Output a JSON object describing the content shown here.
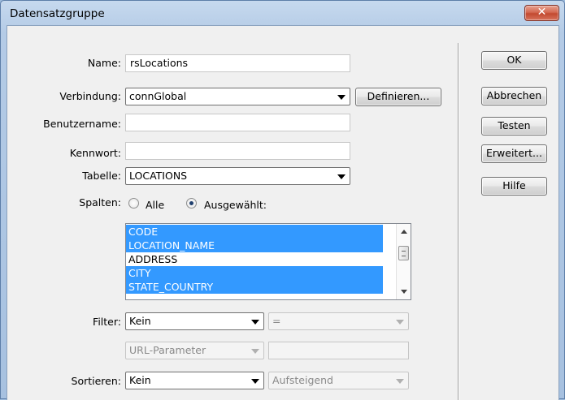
{
  "window": {
    "title": "Datensatzgruppe",
    "close_glyph": "✕"
  },
  "labels": {
    "name": "Name:",
    "connection": "Verbindung:",
    "username": "Benutzername:",
    "password": "Kennwort:",
    "table": "Tabelle:",
    "columns": "Spalten:",
    "filter": "Filter:",
    "sort": "Sortieren:"
  },
  "fields": {
    "name": "rsLocations",
    "connection": "connGlobal",
    "username": "",
    "password": "",
    "table": "LOCATIONS"
  },
  "define_button": "Definieren...",
  "columns": {
    "options": [
      "Alle",
      "Ausgewählt:"
    ],
    "selected_option": "Ausgewählt:",
    "items": [
      {
        "label": "CODE",
        "selected": true
      },
      {
        "label": "LOCATION_NAME",
        "selected": true
      },
      {
        "label": "ADDRESS",
        "selected": false
      },
      {
        "label": "CITY",
        "selected": true
      },
      {
        "label": "STATE_COUNTRY",
        "selected": true
      }
    ]
  },
  "filter": {
    "column": "Kein",
    "operator": "=",
    "source": "URL-Parameter",
    "value": ""
  },
  "sort": {
    "column": "Kein",
    "direction": "Aufsteigend"
  },
  "buttons": {
    "ok": "OK",
    "cancel": "Abbrechen",
    "test": "Testen",
    "advanced": "Erweitert...",
    "help": "Hilfe"
  }
}
